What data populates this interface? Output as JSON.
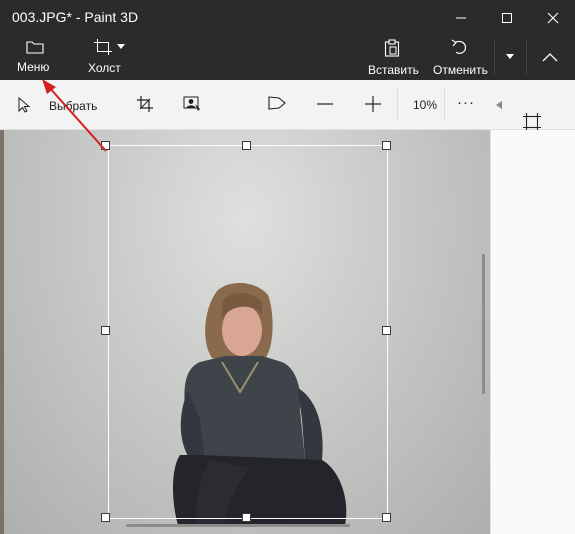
{
  "window": {
    "title": "003.JPG* - Paint 3D"
  },
  "ribbon": {
    "menu_label": "Меню",
    "canvas_label": "Холст",
    "paste_label": "Вставить",
    "undo_label": "Отменить"
  },
  "toolbar": {
    "select_label": "Выбрать",
    "zoom_value": "10%",
    "more_label": "···"
  },
  "colors": {
    "titlebar_bg": "#2b2b2b",
    "toolbar_bg": "#f3f3f3",
    "annotation_arrow": "#d42020"
  },
  "icons": [
    "folder-icon",
    "canvas-crop-icon",
    "chevron-down-icon",
    "clipboard-icon",
    "undo-icon",
    "minimize-icon",
    "maximize-icon",
    "close-icon",
    "select-cursor-icon",
    "crop-icon",
    "magic-select-icon",
    "sticker-flag-icon",
    "zoom-out-icon",
    "zoom-in-icon",
    "canvas-icon",
    "collapse-chevron-icon"
  ]
}
